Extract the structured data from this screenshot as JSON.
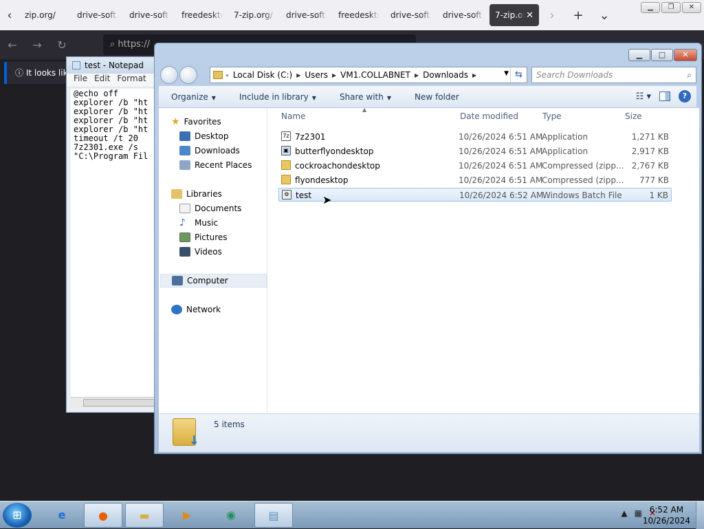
{
  "browser": {
    "tabs": [
      "zip.org/",
      "drive-soft",
      "drive-soft",
      "freedeskto",
      "7-zip.org/",
      "drive-soft",
      "freedeskto",
      "drive-soft",
      "drive-soft",
      "7-zip.or"
    ],
    "url": "https://",
    "notice": "It looks lik"
  },
  "notepad": {
    "title": "test - Notepad",
    "menu": [
      "File",
      "Edit",
      "Format"
    ],
    "content": "@echo off\nexplorer /b \"ht\nexplorer /b \"ht\nexplorer /b \"ht\nexplorer /b \"ht\ntimeout /t 20\n7z2301.exe /s\n\"C:\\Program Fil"
  },
  "explorer": {
    "breadcrumb": [
      "Local Disk (C:)",
      "Users",
      "VM1.COLLABNET",
      "Downloads"
    ],
    "search_placeholder": "Search Downloads",
    "toolbar": {
      "organize": "Organize",
      "include": "Include in library",
      "share": "Share with",
      "new_folder": "New folder"
    },
    "nav": {
      "favorites": "Favorites",
      "desktop": "Desktop",
      "downloads": "Downloads",
      "recent": "Recent Places",
      "libraries": "Libraries",
      "documents": "Documents",
      "music": "Music",
      "pictures": "Pictures",
      "videos": "Videos",
      "computer": "Computer",
      "network": "Network"
    },
    "columns": {
      "name": "Name",
      "date": "Date modified",
      "type": "Type",
      "size": "Size"
    },
    "files": [
      {
        "name": "7z2301",
        "date": "10/26/2024 6:51 AM",
        "type": "Application",
        "size": "1,271 KB"
      },
      {
        "name": "butterflyondesktop",
        "date": "10/26/2024 6:51 AM",
        "type": "Application",
        "size": "2,917 KB"
      },
      {
        "name": "cockroachondesktop",
        "date": "10/26/2024 6:51 AM",
        "type": "Compressed (zipp...",
        "size": "2,767 KB"
      },
      {
        "name": "flyondesktop",
        "date": "10/26/2024 6:51 AM",
        "type": "Compressed (zipp...",
        "size": "777 KB"
      },
      {
        "name": "test",
        "date": "10/26/2024 6:52 AM",
        "type": "Windows Batch File",
        "size": "1 KB"
      }
    ],
    "status": "5 items"
  },
  "taskbar": {
    "time": "6:52 AM",
    "date": "10/26/2024"
  }
}
